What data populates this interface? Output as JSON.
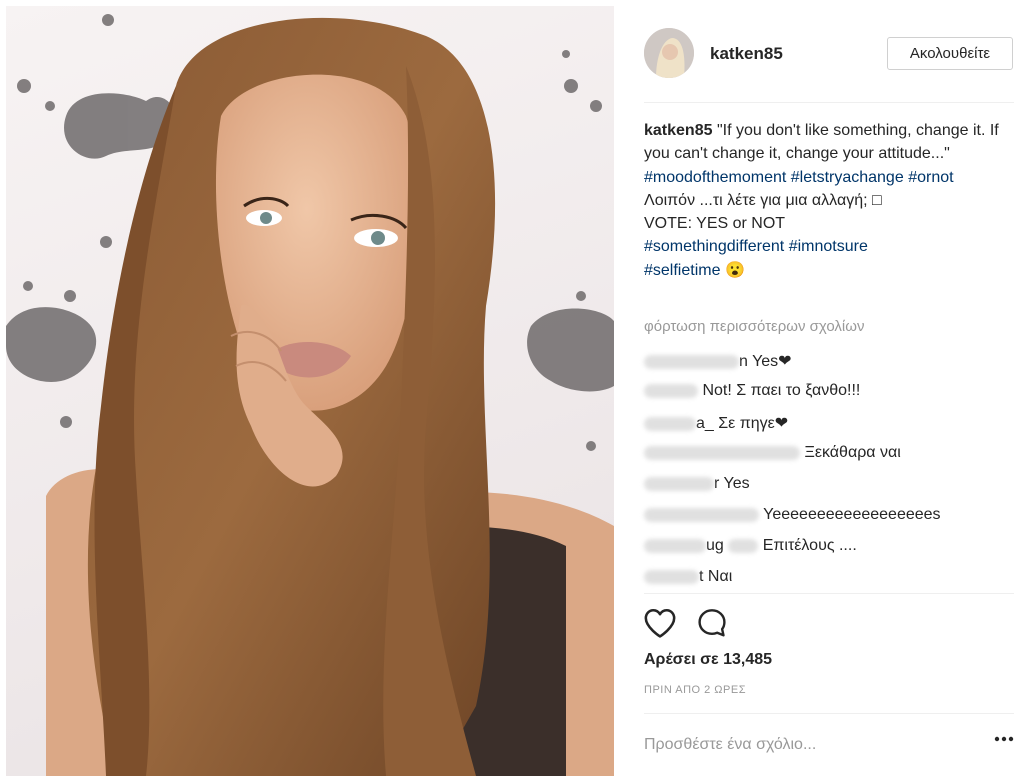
{
  "post": {
    "username": "katken85",
    "follow_label": "Ακολουθείτε",
    "caption": {
      "username": "katken85",
      "line1": "\"If you don't like something, change it. If you can't change it, change your attitude...\"",
      "tag1": "#moodofthemoment",
      "tag2": "#letstryachange",
      "tag3": "#ornot",
      "line2": "Λοιπόν ...τι λέτε για μια αλλαγή; □",
      "line3": "VOTE: YES or NOT",
      "tag4": "#somethingdifferent",
      "tag5": "#imnotsure",
      "tag6": "#selfietime",
      "emoji": "😮"
    },
    "load_more": "φόρτωση περισσότερων σχολίων",
    "comments": [
      {
        "user_fragment": "n",
        "text": "Yes❤"
      },
      {
        "user_fragment": "",
        "text": "Not! Σ παει το ξανθο!!!"
      },
      {
        "user_fragment": "a_",
        "text": "Σε πηγε❤"
      },
      {
        "user_fragment": "",
        "text": "Ξεκάθαρα ναι"
      },
      {
        "user_fragment": "r",
        "text": "Yes"
      },
      {
        "user_fragment": "",
        "text": "Yeeeeeeeeeeeeeeeeees"
      },
      {
        "user_fragment": "ug",
        "text": "Επιτέλους ...."
      },
      {
        "user_fragment": "t",
        "text": "Ναι"
      }
    ],
    "likes": "Αρέσει σε 13,485",
    "time": "ΠΡΙΝ ΑΠΟ 2 ΩΡΕΣ",
    "add_comment_placeholder": "Προσθέστε ένα σχόλιο..."
  },
  "icons": {
    "like": "heart-icon",
    "comment": "speech-bubble-icon",
    "options": "more-options-icon"
  },
  "colors": {
    "hashtag": "#003569",
    "text": "#262626",
    "muted": "#999999"
  }
}
